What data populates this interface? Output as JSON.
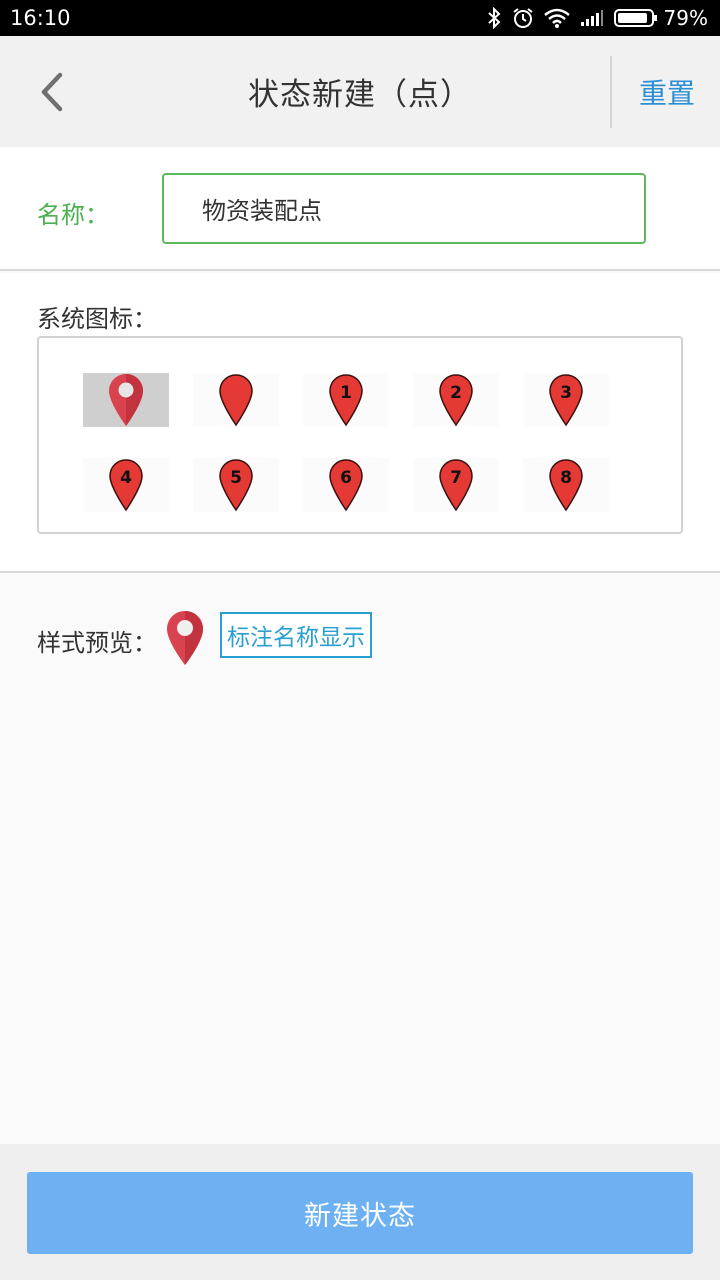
{
  "status_bar": {
    "time": "16:10",
    "battery_percent": "79%",
    "icons": [
      "bluetooth-icon",
      "alarm-icon",
      "wifi-icon",
      "signal-icon",
      "battery-icon"
    ]
  },
  "header": {
    "title": "状态新建（点）",
    "reset_label": "重置"
  },
  "name_field": {
    "label": "名称：",
    "value": "物资装配点"
  },
  "system_icons": {
    "label": "系统图标：",
    "items": [
      {
        "type": "location-pin",
        "number": "",
        "selected": true
      },
      {
        "type": "red-pin",
        "number": "",
        "selected": false
      },
      {
        "type": "red-pin",
        "number": "1",
        "selected": false
      },
      {
        "type": "red-pin",
        "number": "2",
        "selected": false
      },
      {
        "type": "red-pin",
        "number": "3",
        "selected": false
      },
      {
        "type": "red-pin",
        "number": "4",
        "selected": false
      },
      {
        "type": "red-pin",
        "number": "5",
        "selected": false
      },
      {
        "type": "red-pin",
        "number": "6",
        "selected": false
      },
      {
        "type": "red-pin",
        "number": "7",
        "selected": false
      },
      {
        "type": "red-pin",
        "number": "8",
        "selected": false
      }
    ]
  },
  "preview": {
    "label": "样式预览：",
    "tag_text": "标注名称显示"
  },
  "create_button": "新建状态",
  "colors": {
    "accent_blue": "#2b8fd6",
    "label_green": "#4caf50",
    "button_blue": "#6db1f2",
    "pin_red": "#e53935",
    "location_pin_red": "#d9424f"
  }
}
